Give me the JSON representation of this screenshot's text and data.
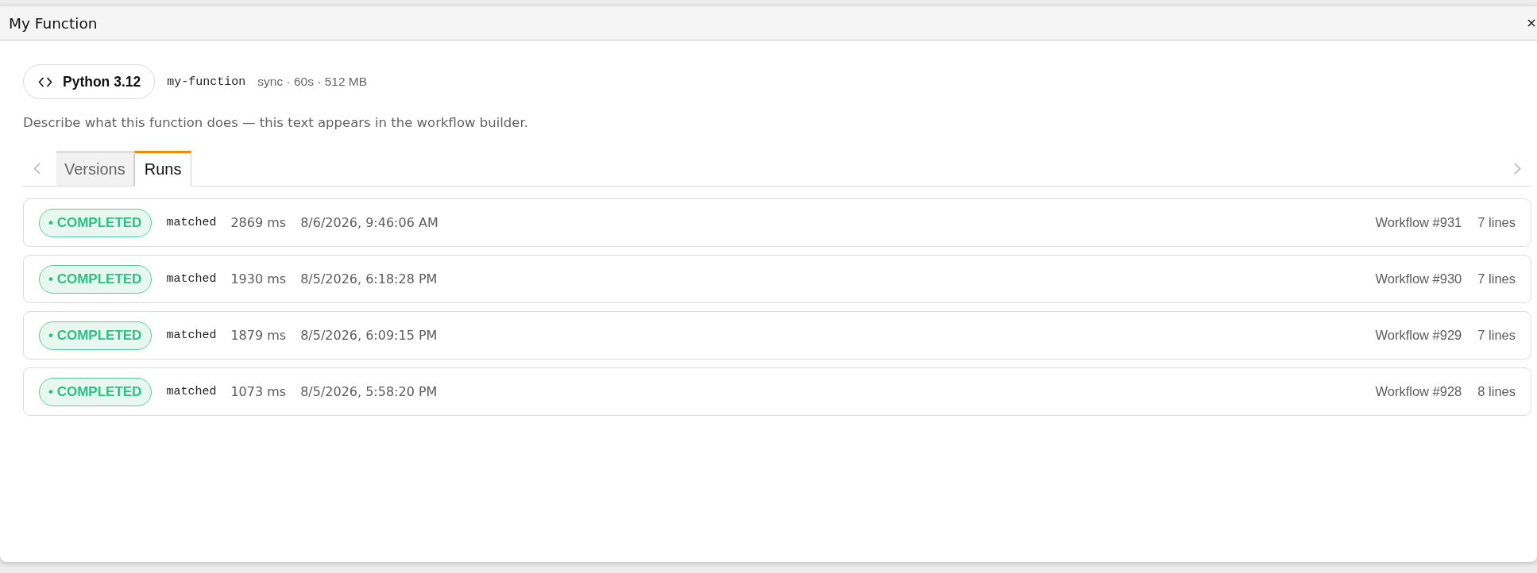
{
  "window": {
    "title": "My Function"
  },
  "header": {
    "runtime": "Python 3.12",
    "name": "my-function",
    "specs": "sync · 60s · 512 MB",
    "description": "Describe what this function does — this text appears in the workflow builder."
  },
  "tabs": [
    {
      "label": "Versions",
      "selected": false
    },
    {
      "label": "Runs",
      "selected": true
    }
  ],
  "runs": [
    {
      "kind": "success",
      "status": "• COMPLETED",
      "result": "matched",
      "duration": "2869 ms",
      "timestamp": "8/6/2026, 9:46:06 AM",
      "workflow": "Workflow #931",
      "lines": "7 lines"
    },
    {
      "kind": "success",
      "status": "• COMPLETED",
      "result": "matched",
      "duration": "1930 ms",
      "timestamp": "8/5/2026, 6:18:28 PM",
      "workflow": "Workflow #930",
      "lines": "7 lines"
    },
    {
      "kind": "success",
      "status": "• COMPLETED",
      "result": "matched",
      "duration": "1879 ms",
      "timestamp": "8/5/2026, 6:09:15 PM",
      "workflow": "Workflow #929",
      "lines": "7 lines"
    },
    {
      "kind": "success",
      "status": "• COMPLETED",
      "result": "matched",
      "duration": "1073 ms",
      "timestamp": "8/5/2026, 5:58:20 PM",
      "workflow": "Workflow #928",
      "lines": "8 lines"
    }
  ]
}
